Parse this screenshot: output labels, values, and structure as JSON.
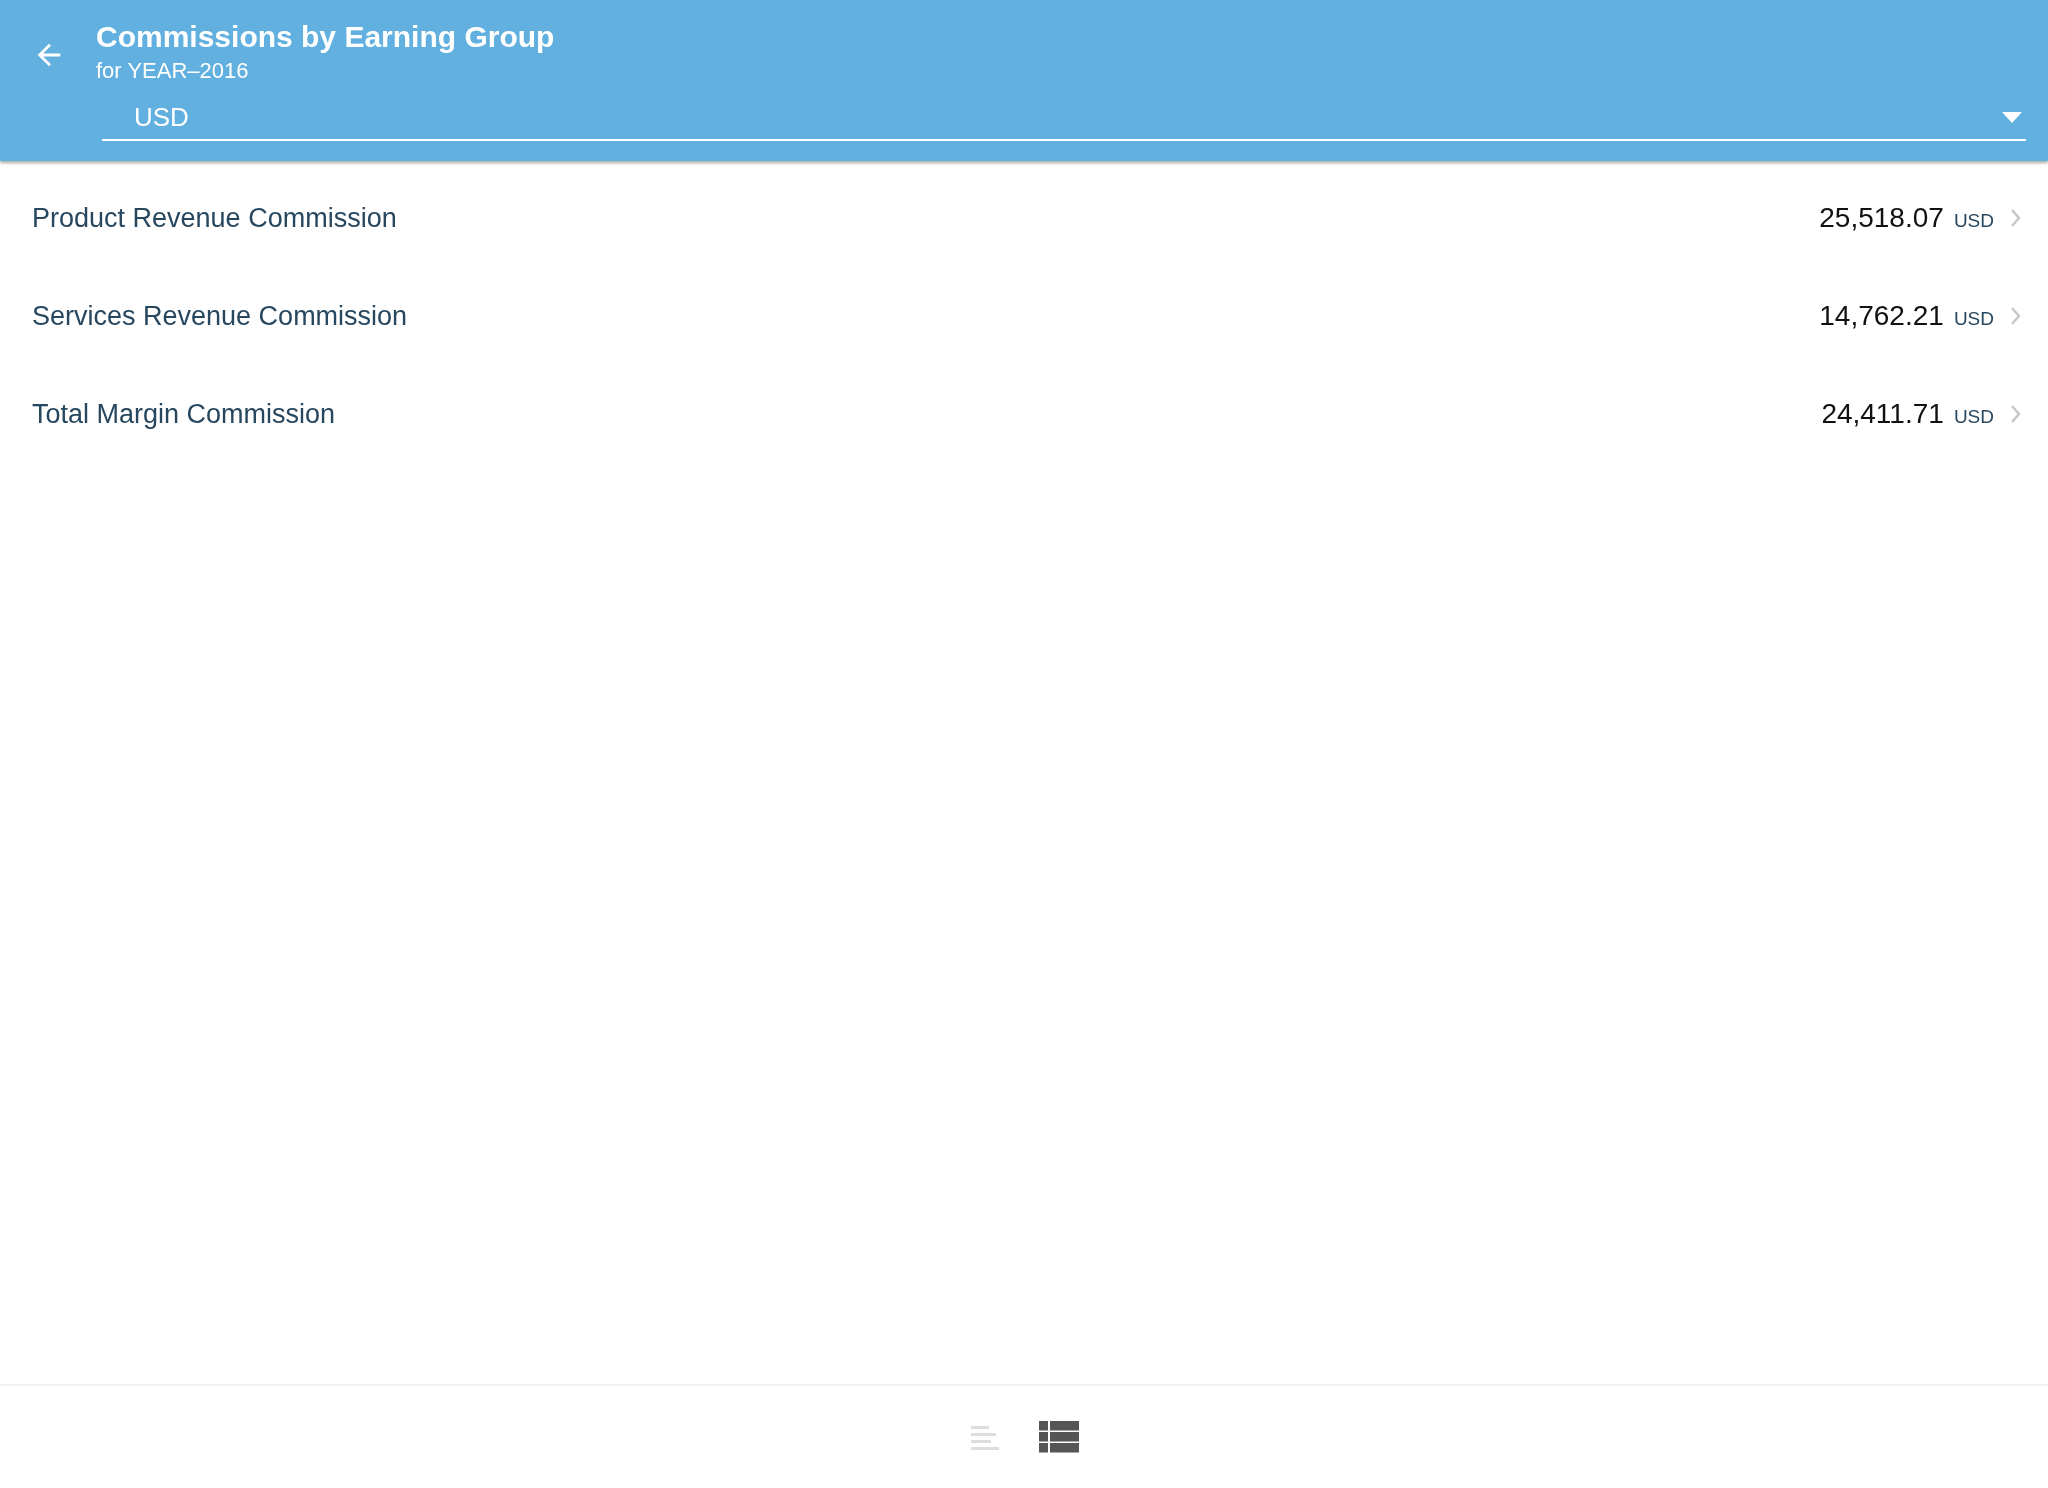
{
  "header": {
    "title": "Commissions by Earning Group",
    "subtitle": "for YEAR–2016",
    "currency_select": {
      "value": "USD"
    }
  },
  "rows": [
    {
      "label": "Product Revenue Commission",
      "amount": "25,518.07",
      "currency": "USD"
    },
    {
      "label": "Services Revenue Commission",
      "amount": "14,762.21",
      "currency": "USD"
    },
    {
      "label": "Total Margin Commission",
      "amount": "24,411.71",
      "currency": "USD"
    }
  ],
  "view_toggle": [
    {
      "kind": "summary",
      "selected": false
    },
    {
      "kind": "table",
      "selected": true
    }
  ]
}
